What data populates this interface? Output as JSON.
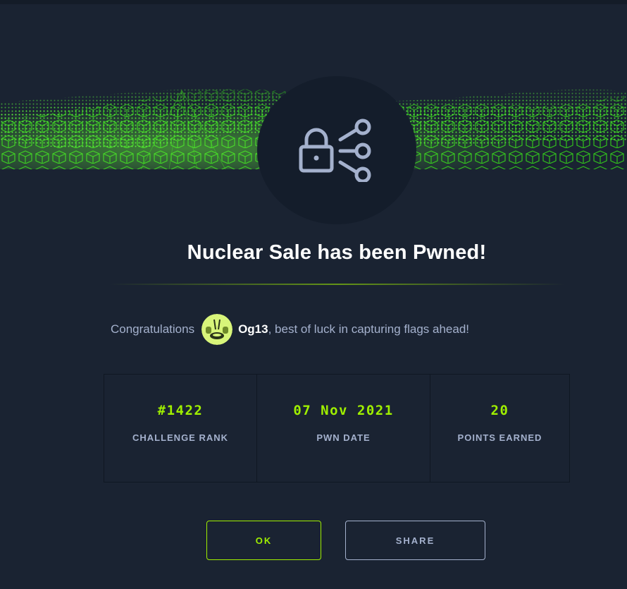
{
  "modal": {
    "title": "Nuclear Sale has been Pwned!",
    "badge_icon": "lock-share-icon",
    "congrats_prefix": "Congratulations",
    "username": "Og13",
    "congrats_suffix": ", best of luck in capturing flags ahead!"
  },
  "stats": [
    {
      "value": "#1422",
      "label": "CHALLENGE RANK"
    },
    {
      "value": "07 Nov 2021",
      "label": "PWN DATE"
    },
    {
      "value": "20",
      "label": "POINTS EARNED"
    }
  ],
  "buttons": {
    "ok_label": "OK",
    "share_label": "SHARE"
  },
  "colors": {
    "background": "#1a2332",
    "accent": "#9fef00",
    "muted_text": "#a4b1cd",
    "badge_bg": "#141d2b"
  }
}
